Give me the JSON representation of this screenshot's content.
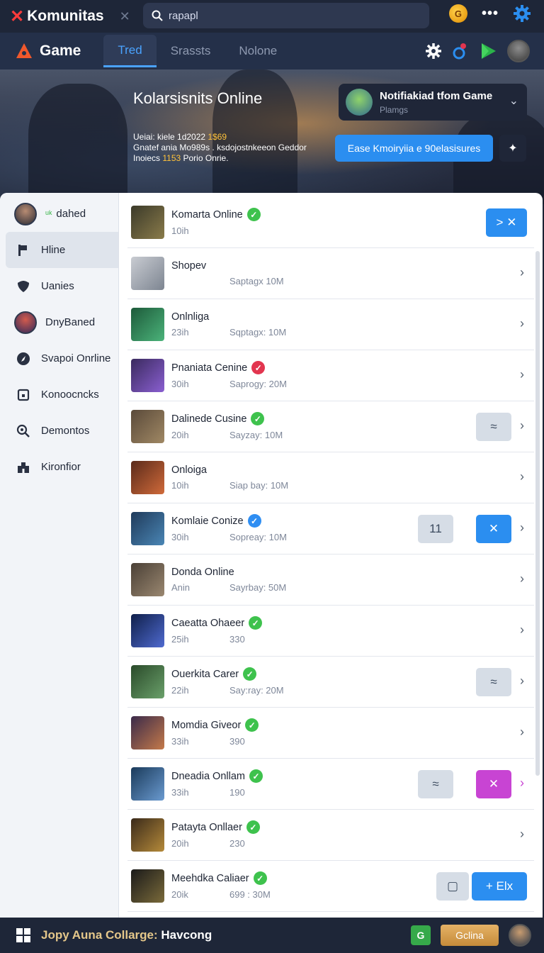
{
  "topbar": {
    "brand": "Komunitas",
    "close_glyph": "✕",
    "search_value": "rapapl",
    "coin_label": "G",
    "icons": [
      "coin-icon",
      "more-icon",
      "gear-icon"
    ]
  },
  "navbar": {
    "title": "Game",
    "tabs": [
      {
        "label": "Tred",
        "active": true
      },
      {
        "label": "Srassts",
        "active": false
      },
      {
        "label": "Nolone",
        "active": false
      }
    ]
  },
  "hero": {
    "title": "Kolarsisnits Online",
    "desc_line1_a": "Ueiai: kiele 1d2022 ",
    "desc_line1_b": "1$69",
    "desc_line2": "Gnatef ania Mo989s . ksdojostnkeeon Geddor",
    "desc_line3_a": "Inoiecs ",
    "desc_line3_b": "1153",
    "desc_line3_c": " Porio Onrie.",
    "notification": {
      "title": "Notifiakiad tfom Game",
      "subtitle": "Plamgs"
    },
    "primary_button": "Ease Kmoiryiia e 90elasisures"
  },
  "sidebar": {
    "items": [
      {
        "label": "dahed",
        "icon": "user-avatar",
        "active": false
      },
      {
        "label": "Hline",
        "icon": "flag-icon",
        "active": true
      },
      {
        "label": "Uanies",
        "icon": "shield-icon",
        "active": false
      },
      {
        "label": "DnyBaned",
        "icon": "user-avatar",
        "active": false
      },
      {
        "label": "Svapoi Onrline",
        "icon": "compass-icon",
        "active": false
      },
      {
        "label": "Konoocncks",
        "icon": "box-icon",
        "active": false
      },
      {
        "label": "Demontos",
        "icon": "search-icon",
        "active": false
      },
      {
        "label": "Kironfior",
        "icon": "castle-icon",
        "active": false
      }
    ]
  },
  "list": {
    "rows": [
      {
        "title": "Komarta Online",
        "badge": "green",
        "time": "10ih",
        "stat": ""
      },
      {
        "title": "Shopev",
        "badge": "",
        "time": "",
        "stat": "Saptagx 10M"
      },
      {
        "title": "Onlnliga",
        "badge": "",
        "time": "23ih",
        "stat": "Sqptagx: 10M"
      },
      {
        "title": "Pnaniata Cenine",
        "badge": "red",
        "time": "30ih",
        "stat": "Saprogy: 20M"
      },
      {
        "title": "Dalinede Cusine",
        "badge": "green",
        "time": "20ih",
        "stat": "Sayzay: 10M"
      },
      {
        "title": "Onloiga",
        "badge": "",
        "time": "10ih",
        "stat": "Siap bay: 10M"
      },
      {
        "title": "Komlaie Conize",
        "badge": "blue",
        "time": "30ih",
        "stat": "Sopreay: 10M"
      },
      {
        "title": "Donda Online",
        "badge": "",
        "time": "Anin",
        "stat": "Sayrbay: 50M"
      },
      {
        "title": "Caeatta Ohaeer",
        "badge": "green",
        "time": "25ih",
        "stat": "330"
      },
      {
        "title": "Ouerkita Carer",
        "badge": "green",
        "time": "22ih",
        "stat": "Say:ray: 20M"
      },
      {
        "title": "Momdia Giveor",
        "badge": "green",
        "time": "33ih",
        "stat": "390"
      },
      {
        "title": "Dneadia Onllam",
        "badge": "green",
        "time": "33ih",
        "stat": "190"
      },
      {
        "title": "Patayta Onllaer",
        "badge": "green",
        "time": "20ih",
        "stat": "230"
      },
      {
        "title": "Meehdka Caliaer",
        "badge": "green",
        "time": "20ik",
        "stat": "699 : 30M"
      }
    ],
    "row0_action": "> ✕",
    "row6_count": "11",
    "row13_action": "+ Elx"
  },
  "bottombar": {
    "text_a": "Jopy Auna Collarge: ",
    "text_b": "Havcong",
    "green_label": "G",
    "gold_button": "Gclina"
  },
  "colors": {
    "accent_blue": "#2b8ef0",
    "badge_green": "#3ec24d",
    "badge_red": "#e2354f",
    "magenta": "#c844d3"
  }
}
